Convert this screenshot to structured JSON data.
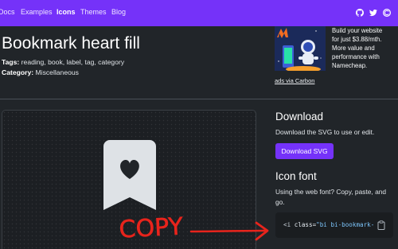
{
  "nav": {
    "links": [
      "Docs",
      "Examples",
      "Icons",
      "Themes",
      "Blog"
    ],
    "active_link": "Icons",
    "icons": [
      "github-icon",
      "twitter-icon",
      "opencollective-icon"
    ]
  },
  "page": {
    "title": "Bookmark heart fill",
    "tags_label": "Tags:",
    "tags": "reading, book, label, tag, category",
    "category_label": "Category:",
    "category": "Miscellaneous"
  },
  "ad": {
    "lines": [
      "Build your website",
      "for just $3.88/mth.",
      "More value and",
      "performance with",
      "Namecheap."
    ],
    "link": "ads via Carbon"
  },
  "preview": {
    "icon": "bookmark-heart-fill-icon"
  },
  "download": {
    "heading": "Download",
    "text": "Download the SVG to use or edit.",
    "button": "Download SVG"
  },
  "icon_font": {
    "heading": "Icon font",
    "text_line1": "Using the web font? Copy, paste, and",
    "text_line2": "go.",
    "code_tag": "<i ",
    "code_attr": "class=",
    "code_value": "\"bi bi-bookmark-",
    "copy_icon": "clipboard-icon"
  },
  "annotation": {
    "text": "COPY",
    "color": "#e8241c"
  },
  "colors": {
    "brand": "#7532f9",
    "background": "#212529"
  }
}
